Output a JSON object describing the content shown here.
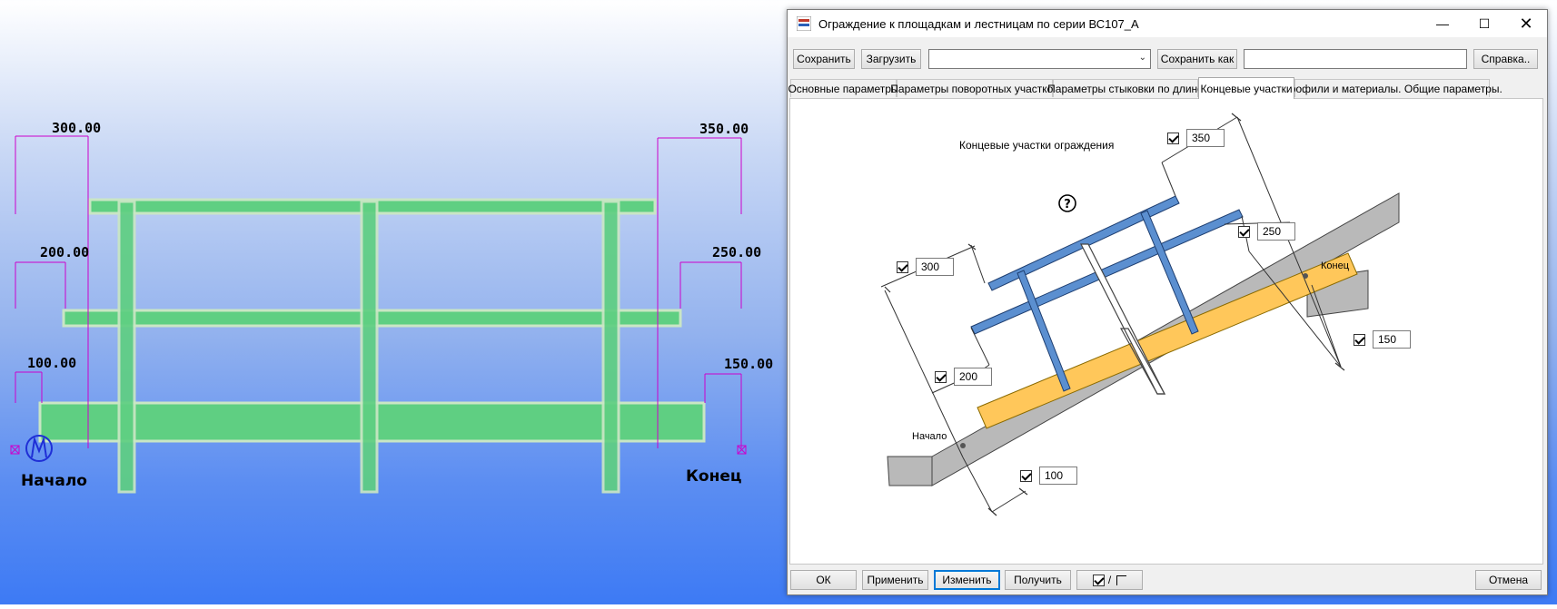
{
  "viewport": {
    "dims_left": [
      "300.00",
      "200.00",
      "100.00"
    ],
    "dims_right": [
      "350.00",
      "250.00",
      "150.00"
    ],
    "start_label": "Начало",
    "end_label": "Конец"
  },
  "dialog": {
    "title": "Ограждение к площадкам и лестницам по серии ВС107_А",
    "toolbar": {
      "save": "Сохранить",
      "load": "Загрузить",
      "preset_value": "",
      "save_as": "Сохранить как",
      "save_as_name": "",
      "help": "Справка.."
    },
    "tabs": [
      {
        "label": "Основные параметры"
      },
      {
        "label": "Параметры поворотных участков"
      },
      {
        "label": "Параметры стыковки по длине"
      },
      {
        "label": "Концевые участки"
      },
      {
        "label": "Профили и материалы. Общие параметры."
      }
    ],
    "active_tab": "Концевые участки",
    "page": {
      "caption": "Концевые участки ограждения",
      "help_glyph": "?",
      "start_label": "Начало",
      "end_label": "Конец",
      "fields": {
        "start_top": "300",
        "start_mid": "200",
        "start_low": "100",
        "end_top": "350",
        "end_mid": "250",
        "end_low": "150"
      }
    },
    "buttons": {
      "ok": "ОК",
      "apply": "Применить",
      "modify": "Изменить",
      "get": "Получить",
      "toggle": "/",
      "cancel": "Отмена"
    }
  },
  "colors": {
    "rail_green": "#5fcf82",
    "dim_magenta": "#cc00cc",
    "beam_blue": "#5b8fd0",
    "board_yellow": "#ffc75a",
    "slab_gray": "#b9b9b9"
  }
}
